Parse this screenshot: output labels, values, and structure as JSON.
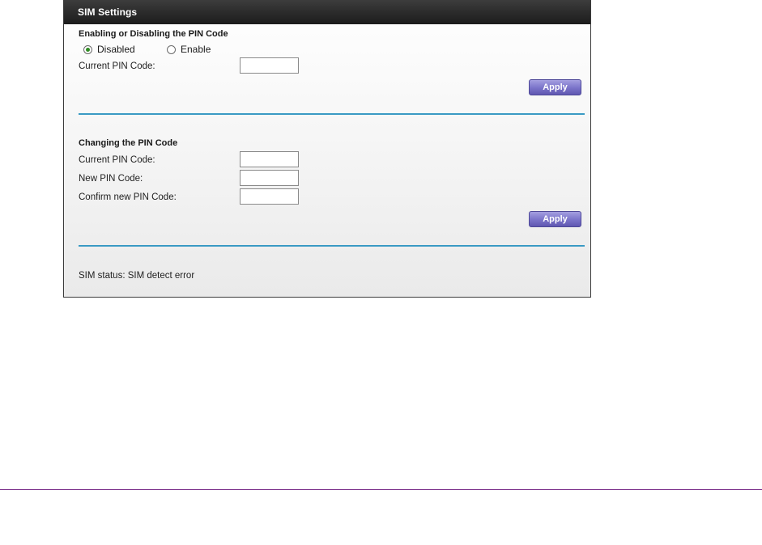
{
  "panel": {
    "title": "SIM Settings"
  },
  "pin_enable": {
    "heading": "Enabling or Disabling the PIN Code",
    "options": [
      {
        "label": "Disabled",
        "checked": true
      },
      {
        "label": "Enable",
        "checked": false
      }
    ],
    "current_pin_label": "Current PIN Code:",
    "current_pin_value": "",
    "apply_label": "Apply"
  },
  "pin_change": {
    "heading": "Changing the PIN Code",
    "current_pin_label": "Current PIN Code:",
    "new_pin_label": "New PIN Code:",
    "confirm_pin_label": "Confirm new PIN Code:",
    "current_pin_value": "",
    "new_pin_value": "",
    "confirm_pin_value": "",
    "apply_label": "Apply"
  },
  "status": {
    "text": "SIM status: SIM detect error"
  },
  "colors": {
    "titlebar": "#2a2a2a",
    "divider": "#3a9ac4",
    "apply_button": "#7a73c9",
    "radio_checked": "#2e8b22",
    "page_rule": "#7a2e8a"
  }
}
